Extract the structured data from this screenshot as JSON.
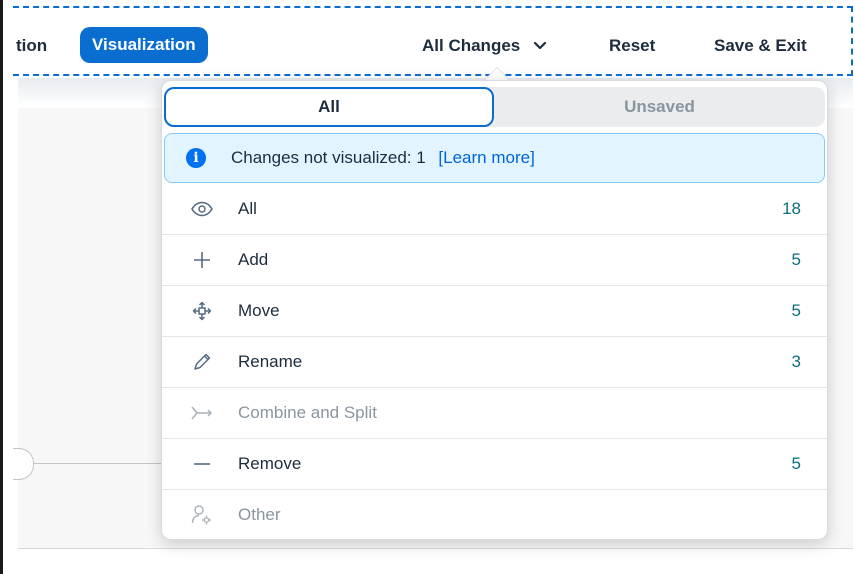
{
  "toolbar": {
    "tab_adaptation": "tion",
    "tab_visualization": "Visualization",
    "all_changes_label": "All Changes",
    "reset_label": "Reset",
    "save_exit_label": "Save & Exit"
  },
  "popover": {
    "segments": {
      "all": "All",
      "unsaved": "Unsaved",
      "selected": "All"
    },
    "info": {
      "text": "Changes not visualized: 1",
      "link": "[Learn more]",
      "icon": "info-icon"
    },
    "items": [
      {
        "label": "All",
        "count": "18",
        "icon": "eye-icon",
        "enabled": true
      },
      {
        "label": "Add",
        "count": "5",
        "icon": "plus-icon",
        "enabled": true
      },
      {
        "label": "Move",
        "count": "5",
        "icon": "move-arrows-icon",
        "enabled": true
      },
      {
        "label": "Rename",
        "count": "3",
        "icon": "pencil-icon",
        "enabled": true
      },
      {
        "label": "Combine and Split",
        "count": "",
        "icon": "combine-split-icon",
        "enabled": false
      },
      {
        "label": "Remove",
        "count": "5",
        "icon": "minus-icon",
        "enabled": true
      },
      {
        "label": "Other",
        "count": "",
        "icon": "person-settings-icon",
        "enabled": false
      }
    ]
  },
  "colors": {
    "accent": "#0a6ed1",
    "count": "#0b6e7e",
    "info_bg": "#e1f4ff",
    "disabled": "#8a95a0"
  }
}
